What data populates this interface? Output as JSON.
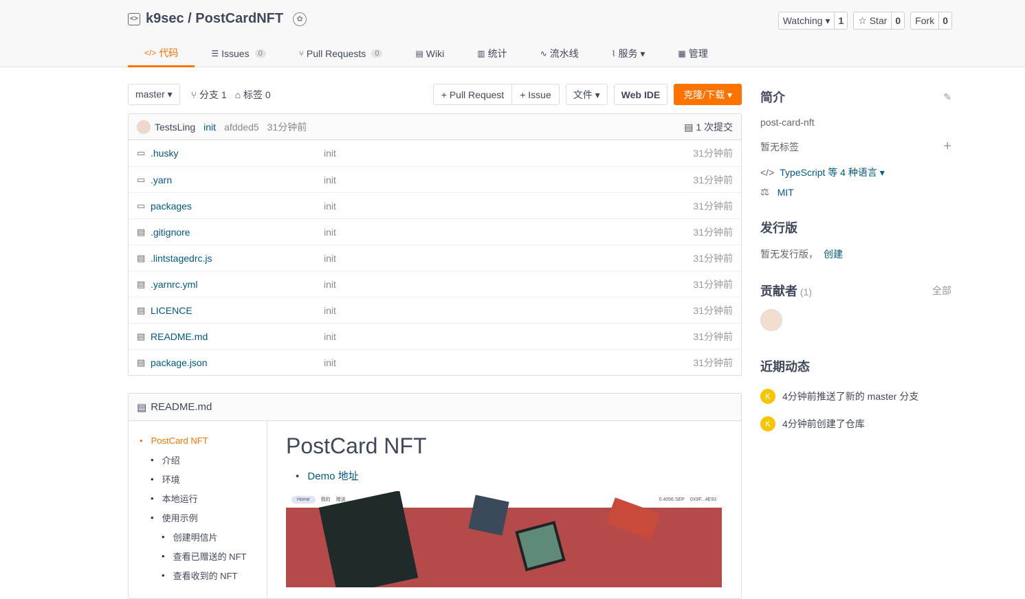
{
  "repo": {
    "owner": "k9sec",
    "name": "PostCardNFT",
    "title": "k9sec / PostCardNFT"
  },
  "actions": [
    {
      "label": "Watching ▾",
      "count": "1"
    },
    {
      "label": "☆ Star",
      "count": "0"
    },
    {
      "label": "Fork",
      "count": "0"
    }
  ],
  "tabs": [
    {
      "label": "代码",
      "active": true
    },
    {
      "label": "Issues",
      "count": "0"
    },
    {
      "label": "Pull Requests",
      "count": "0"
    },
    {
      "label": "Wiki"
    },
    {
      "label": "统计"
    },
    {
      "label": "流水线"
    },
    {
      "label": "服务 ▾"
    },
    {
      "label": "管理"
    }
  ],
  "toolbar": {
    "branch": "master ▾",
    "branches": "分支 1",
    "tags": "标签 0",
    "pull_request": "+ Pull Request",
    "issue": "+ Issue",
    "file": "文件 ▾",
    "web_ide": "Web IDE",
    "clone": "克隆/下载 ▾"
  },
  "commit": {
    "author": "TestsLing",
    "message": "init",
    "hash": "afdded5",
    "time": "31分钟前",
    "count": "1 次提交"
  },
  "files": [
    {
      "name": ".husky",
      "type": "dir",
      "msg": "init",
      "time": "31分钟前"
    },
    {
      "name": ".yarn",
      "type": "dir",
      "msg": "init",
      "time": "31分钟前"
    },
    {
      "name": "packages",
      "type": "dir",
      "msg": "init",
      "time": "31分钟前"
    },
    {
      "name": ".gitignore",
      "type": "file",
      "msg": "init",
      "time": "31分钟前"
    },
    {
      "name": ".lintstagedrc.js",
      "type": "file",
      "msg": "init",
      "time": "31分钟前"
    },
    {
      "name": ".yarnrc.yml",
      "type": "file",
      "msg": "init",
      "time": "31分钟前"
    },
    {
      "name": "LICENCE",
      "type": "file",
      "msg": "init",
      "time": "31分钟前"
    },
    {
      "name": "README.md",
      "type": "file",
      "msg": "init",
      "time": "31分钟前"
    },
    {
      "name": "package.json",
      "type": "file",
      "msg": "init",
      "time": "31分钟前"
    }
  ],
  "readme": {
    "title": "README.md",
    "h1": "PostCard NFT",
    "demo": "Demo 地址",
    "toc": [
      {
        "t": "PostCard NFT",
        "l": 1
      },
      {
        "t": "介绍",
        "l": 2
      },
      {
        "t": "环境",
        "l": 2
      },
      {
        "t": "本地运行",
        "l": 2
      },
      {
        "t": "使用示例",
        "l": 2
      },
      {
        "t": "创建明信片",
        "l": 3
      },
      {
        "t": "查看已赠送的 NFT",
        "l": 3
      },
      {
        "t": "查看收到的 NFT",
        "l": 3
      }
    ],
    "shot_nav": [
      "Home",
      "我的",
      "赠送"
    ],
    "shot_balance": "0.4056 SEP",
    "shot_addr": "0X9F...4E93"
  },
  "side": {
    "intro": "简介",
    "desc": "post-card-nft",
    "no_tags": "暂无标签",
    "lang": "TypeScript 等 4 种语言 ▾",
    "license": "MIT",
    "release": "发行版",
    "no_release": "暂无发行版，",
    "create": "创建",
    "contrib": "贡献者",
    "contrib_count": "(1)",
    "all": "全部",
    "activity": "近期动态",
    "events": [
      "4分钟前推送了新的 master 分支",
      "4分钟前创建了仓库"
    ]
  }
}
